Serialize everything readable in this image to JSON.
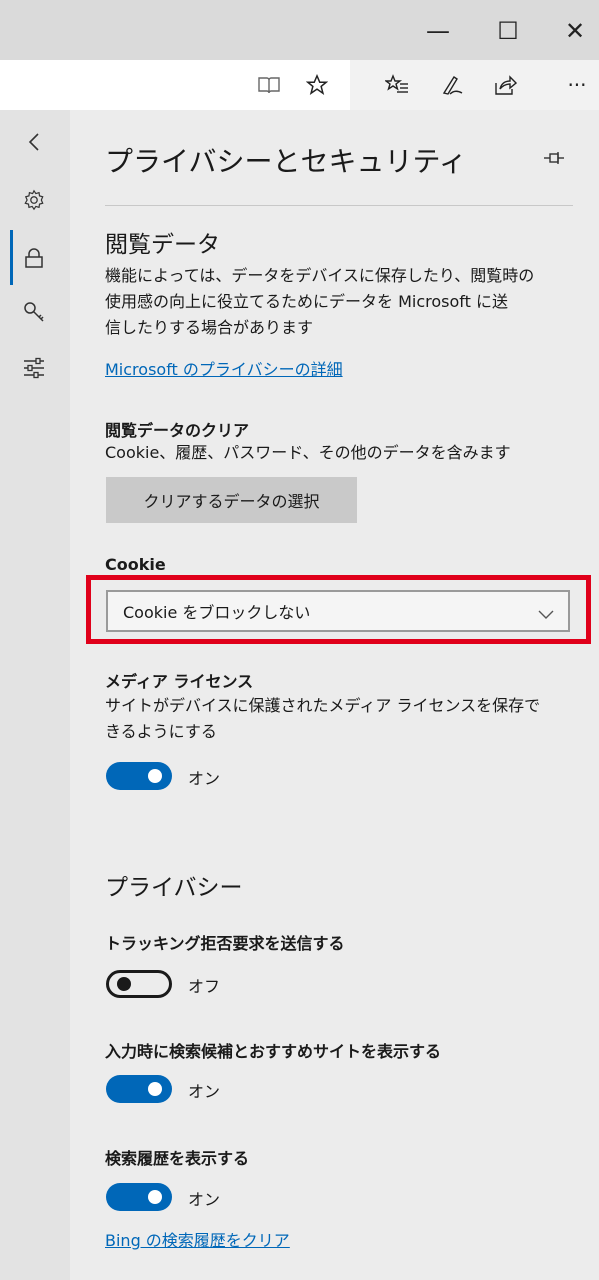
{
  "window_controls": {
    "minimize": "—",
    "maximize": "☐",
    "close": "✕"
  },
  "toolbar": {
    "more_label": "···"
  },
  "icons": {
    "reading_view": "reading-view-icon",
    "favorite": "star-icon",
    "favorites_hub": "favorites-list-icon",
    "web_note": "pen-icon",
    "share": "share-icon",
    "back": "chevron-left-icon",
    "settings": "gear-icon",
    "privacy": "lock-icon",
    "passwords": "key-icon",
    "advanced": "sliders-icon",
    "pin": "pin-icon"
  },
  "panel": {
    "title": "プライバシーとセキュリティ",
    "browsing_data": {
      "heading": "閲覧データ",
      "description_lines": [
        "機能によっては、データをデバイスに保存したり、閲覧時の",
        "使用感の向上に役立てるためにデータを Microsoft に送",
        "信したりする場合があります"
      ],
      "link": "Microsoft のプライバシーの詳細"
    },
    "clear_data": {
      "label": "閲覧データのクリア",
      "description": "Cookie、履歴、パスワード、その他のデータを含みます",
      "button": "クリアするデータの選択"
    },
    "cookie": {
      "label": "Cookie",
      "selected": "Cookie をブロックしない"
    },
    "media_license": {
      "label": "メディア ライセンス",
      "description_lines": [
        "サイトがデバイスに保護されたメディア ライセンスを保存で",
        "きるようにする"
      ],
      "toggle_text": "オン",
      "on": true
    },
    "privacy": {
      "heading": "プライバシー",
      "dnt": {
        "label": "トラッキング拒否要求を送信する",
        "toggle_text": "オフ",
        "on": false
      },
      "suggestions": {
        "label": "入力時に検索候補とおすすめサイトを表示する",
        "toggle_text": "オン",
        "on": true
      },
      "search_history": {
        "label": "検索履歴を表示する",
        "toggle_text": "オン",
        "on": true
      },
      "bing_link": "Bing の検索履歴をクリア"
    }
  },
  "colors": {
    "accent": "#0067b8",
    "highlight": "#e0001a"
  }
}
